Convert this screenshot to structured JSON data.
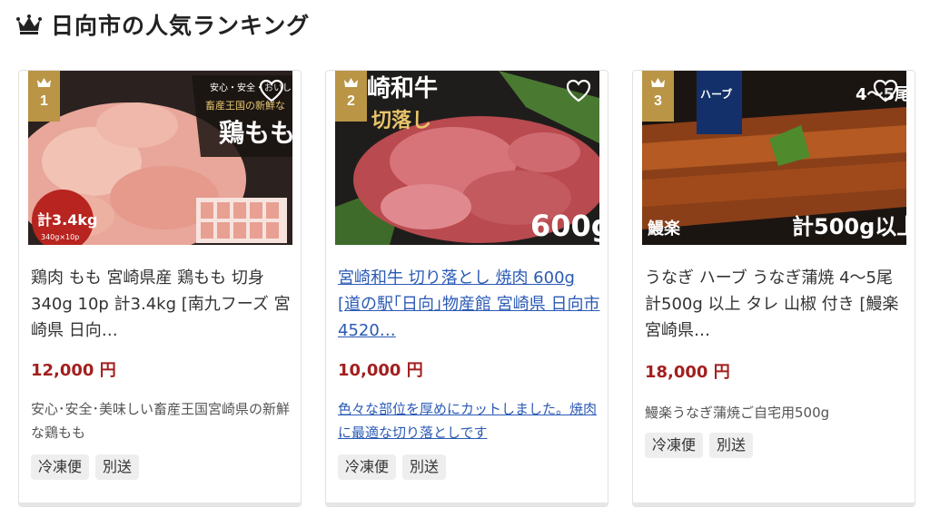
{
  "page": {
    "title": "日向市の人気ランキング",
    "crown_icon": "crown-icon"
  },
  "colors": {
    "badge": "#b99545",
    "price": "#a31f1f",
    "link": "#2a5ab5",
    "tag_bg": "#eeeeee"
  },
  "cards": [
    {
      "rank": "1",
      "image_text": {
        "main": "鶏もも",
        "top": "安心・安全・おいし",
        "sub": "畜産王国の新鮮な",
        "weight": "計3.4kg",
        "weight_sub": "340g×10p"
      },
      "title": "鶏肉 もも 宮崎県産 鶏もも 切身 340g 10p 計3.4kg [南九フーズ 宮崎県 日向…",
      "price": "12,000 円",
      "description": "安心･安全･美味しい畜産王国宮崎県の新鮮な鶏もも",
      "tags": [
        "冷凍便",
        "別送"
      ],
      "linked": false
    },
    {
      "rank": "2",
      "image_text": {
        "main": "崎和牛",
        "sub": "切落し",
        "weight": "600g"
      },
      "title": "宮崎和牛 切り落とし 焼肉 600g [道の駅｢日向｣物産館 宮崎県 日向市 4520…",
      "price": "10,000 円",
      "description": "色々な部位を厚めにカットしました。焼肉に最適な切り落としです",
      "tags": [
        "冷凍便",
        "別送"
      ],
      "linked": true
    },
    {
      "rank": "3",
      "image_text": {
        "main": "ハーブ",
        "top": "4〜5尾",
        "logo": "鰻楽",
        "weight": "計500g以上"
      },
      "title": "うなぎ ハーブ うなぎ蒲焼 4〜5尾 計500g 以上 タレ 山椒 付き [鰻楽 宮崎県…",
      "price": "18,000 円",
      "description": "鰻楽うなぎ蒲焼ご自宅用500g",
      "tags": [
        "冷凍便",
        "別送"
      ],
      "linked": false
    }
  ]
}
